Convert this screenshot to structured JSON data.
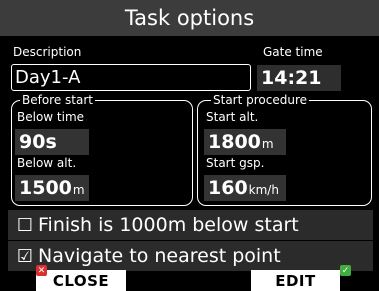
{
  "title": "Task options",
  "description": {
    "label": "Description",
    "value": "Day1-A"
  },
  "gate_time": {
    "label": "Gate time",
    "value": "14:21"
  },
  "before_start": {
    "legend": "Before start",
    "below_time_label": "Below time",
    "below_time_value": "90s",
    "below_alt_label": "Below alt.",
    "below_alt_value": "1500",
    "below_alt_unit": "m"
  },
  "start_procedure": {
    "legend": "Start procedure",
    "start_alt_label": "Start alt.",
    "start_alt_value": "1800",
    "start_alt_unit": "m",
    "start_gsp_label": "Start gsp.",
    "start_gsp_value": "160",
    "start_gsp_unit": "km/h"
  },
  "options": [
    {
      "checkbox": "☐",
      "label": "Finish is 1000m below start",
      "checked": false
    },
    {
      "checkbox": "☑",
      "label": "Navigate to nearest point",
      "checked": true
    }
  ],
  "buttons": {
    "close": "CLOSE",
    "edit": "EDIT"
  },
  "colors": {
    "title_bg": "#3c3c3c",
    "close_badge": "#d93030",
    "edit_badge": "#3fae3f"
  }
}
